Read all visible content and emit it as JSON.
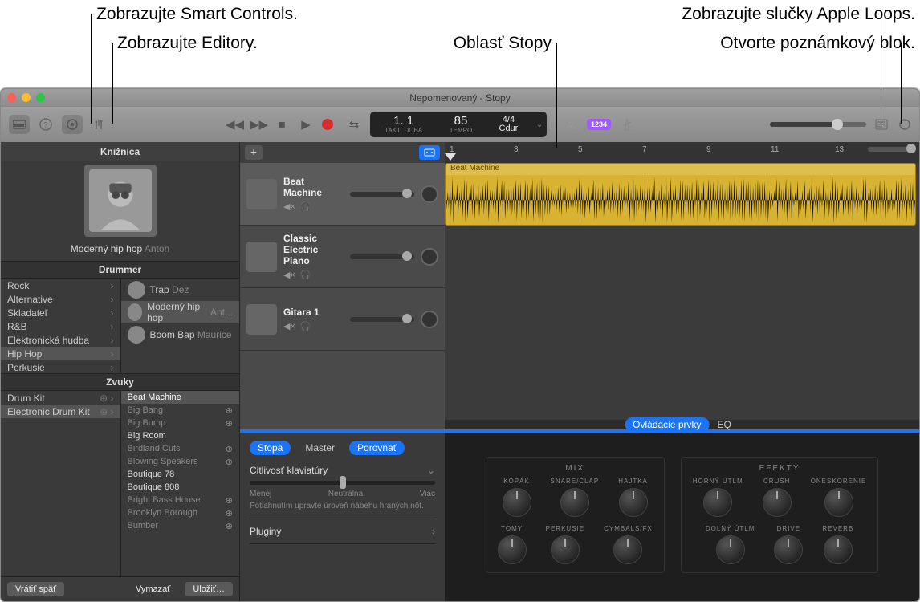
{
  "annotations": {
    "smart_controls": "Zobrazujte Smart Controls.",
    "editors": "Zobrazujte Editory.",
    "tracks_area": "Oblasť Stopy",
    "loops": "Zobrazujte slučky Apple Loops.",
    "notepad": "Otvorte poznámkový blok."
  },
  "window": {
    "title": "Nepomenovaný - Stopy"
  },
  "lcd": {
    "takt_label": "TAKT",
    "pos": "1. 1",
    "doba_label": "DOBA",
    "doba": "1",
    "tempo_label": "TEMPO",
    "tempo": "85",
    "sig": "4/4",
    "key": "Cdur"
  },
  "count_badge": "1234",
  "library": {
    "title": "Knižnica",
    "preset_name": "Moderný hip hop",
    "preset_author": "Anton",
    "section_drummer": "Drummer",
    "genres": [
      "Rock",
      "Alternative",
      "Skladateľ",
      "R&B",
      "Elektronická hudba",
      "Hip Hop",
      "Perkusie"
    ],
    "drummers": [
      {
        "name": "Trap",
        "author": "Dez"
      },
      {
        "name": "Moderný hip hop",
        "author": "Ant..."
      },
      {
        "name": "Boom Bap",
        "author": "Maurice"
      }
    ],
    "section_sounds": "Zvuky",
    "kits": [
      "Drum Kit",
      "Electronic Drum Kit"
    ],
    "sounds": [
      {
        "label": "Beat Machine",
        "on": true,
        "sel": true
      },
      {
        "label": "Big Bang",
        "on": false
      },
      {
        "label": "Big Bump",
        "on": false
      },
      {
        "label": "Big Room",
        "on": true
      },
      {
        "label": "Birdland Cuts",
        "on": false
      },
      {
        "label": "Blowing Speakers",
        "on": false
      },
      {
        "label": "Boutique 78",
        "on": true
      },
      {
        "label": "Boutique 808",
        "on": true
      },
      {
        "label": "Bright Bass House",
        "on": false
      },
      {
        "label": "Brooklyn Borough",
        "on": false
      },
      {
        "label": "Bumber",
        "on": false
      }
    ],
    "footer": {
      "undo": "Vrátiť späť",
      "delete": "Vymazať",
      "save": "Uložiť…"
    }
  },
  "tracks": [
    {
      "name": "Beat Machine",
      "sel": true
    },
    {
      "name": "Classic Electric Piano",
      "sel": false
    },
    {
      "name": "Gitara 1",
      "sel": false
    }
  ],
  "region_label": "Beat Machine",
  "ruler_marks": [
    "1",
    "3",
    "5",
    "7",
    "9",
    "11",
    "13"
  ],
  "smart": {
    "tabs": {
      "track": "Stopa",
      "master": "Master",
      "compare": "Porovnať"
    },
    "modes": {
      "controls": "Ovládacie prvky",
      "eq": "EQ"
    },
    "sens_title": "Citlivosť klaviatúry",
    "sens_less": "Menej",
    "sens_neutral": "Neutrálna",
    "sens_more": "Viac",
    "sens_hint": "Potiahnutím upravte úroveň nábehu hraných nôt.",
    "plugins": "Pluginy",
    "mix_title": "MIX",
    "fx_title": "EFEKTY",
    "mix_knobs_row1": [
      "KOPÁK",
      "SNARE/CLAP",
      "HAJTKA"
    ],
    "mix_knobs_row2": [
      "TOMY",
      "PERKUSIE",
      "CYMBALS/FX"
    ],
    "fx_knobs_row1": [
      "HORNÝ ÚTLM",
      "CRUSH",
      "ONESKORENIE"
    ],
    "fx_knobs_row2": [
      "DOLNÝ ÚTLM",
      "DRIVE",
      "REVERB"
    ]
  }
}
